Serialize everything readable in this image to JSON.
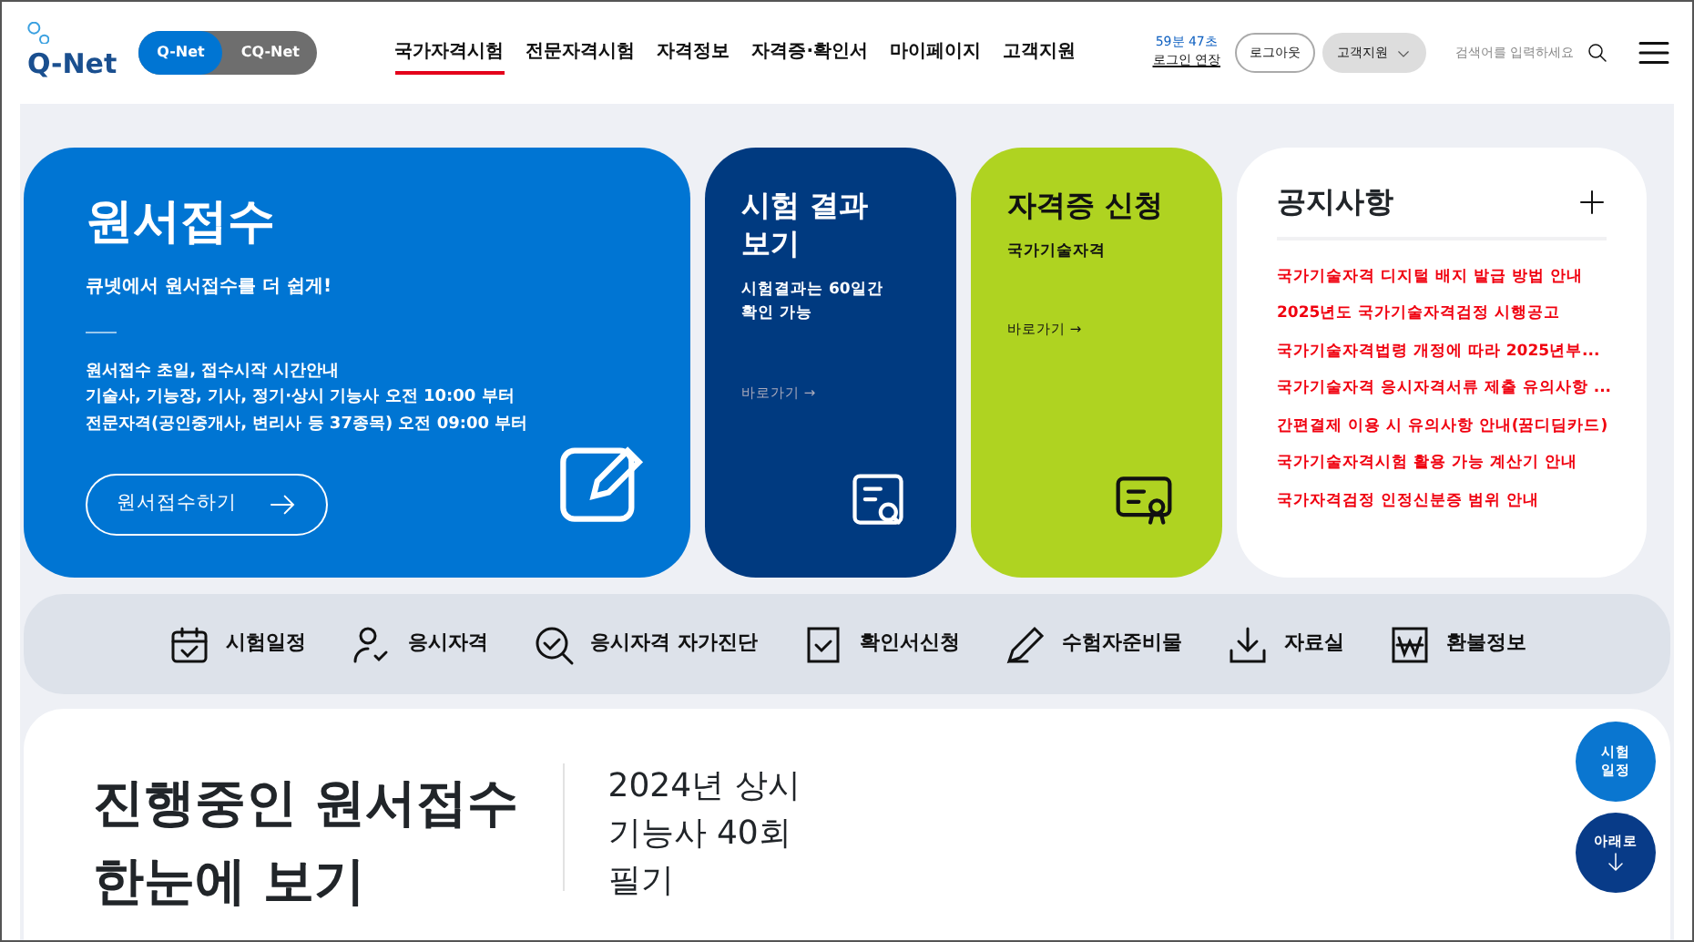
{
  "header": {
    "logo": "Q-Net",
    "site_switch": [
      {
        "label": "Q-Net",
        "selected": true
      },
      {
        "label": "CQ-Net",
        "selected": false
      }
    ],
    "nav": [
      {
        "label": "국가자격시험",
        "selected": true
      },
      {
        "label": "전문자격시험",
        "selected": false
      },
      {
        "label": "자격정보",
        "selected": false
      },
      {
        "label": "자격증·확인서",
        "selected": false
      },
      {
        "label": "마이페이지",
        "selected": false
      },
      {
        "label": "고객지원",
        "selected": false
      }
    ],
    "session_timer": "59분 47초",
    "session_extend": "로그인 연장",
    "logout": "로그아웃",
    "support_menu": "고객지원",
    "search": {
      "placeholder": "검색어를 입력하세요"
    }
  },
  "cards": {
    "apply": {
      "title": "원서접수",
      "subtitle": "큐넷에서 원서접수를 더 쉽게!",
      "lines": [
        "원서접수 초일, 접수시작 시간안내",
        "기술사, 기능장, 기사, 정기·상시 기능사 오전 10:00 부터",
        "전문자격(공인중개사, 변리사 등 37종목) 오전 09:00 부터"
      ],
      "button": "원서접수하기"
    },
    "result": {
      "title": "시험 결과 보기",
      "desc": "시험결과는 60일간 확인 가능",
      "link": "바로가기 →"
    },
    "certificate": {
      "title": "자격증 신청",
      "desc": "국가기술자격",
      "link": "바로가기 →"
    },
    "notices": {
      "title": "공지사항",
      "items": [
        "국가기술자격 디지털 배지 발급 방법 안내",
        "2025년도 국가기술자격검정 시행공고",
        "국가기술자격법령 개정에 따라 2025년부...",
        "국가기술자격 응시자격서류 제출 유의사항 ...",
        "간편결제 이용 시 유의사항 안내(꿈디딤카드)",
        "국가기술자격시험 활용 가능 계산기 안내",
        "국가자격검정 인정신분증 범위 안내"
      ]
    }
  },
  "quick_links": [
    "시험일정",
    "응시자격",
    "응시자격 자가진단",
    "확인서신청",
    "수험자준비물",
    "자료실",
    "환불정보"
  ],
  "ongoing": {
    "title": [
      "진행중인 원서접수",
      "한눈에 보기"
    ],
    "exam": [
      "2024년 상시",
      "기능사 40회",
      "필기"
    ]
  },
  "floating": {
    "schedule": [
      "시험",
      "일정"
    ],
    "down": "아래로"
  }
}
